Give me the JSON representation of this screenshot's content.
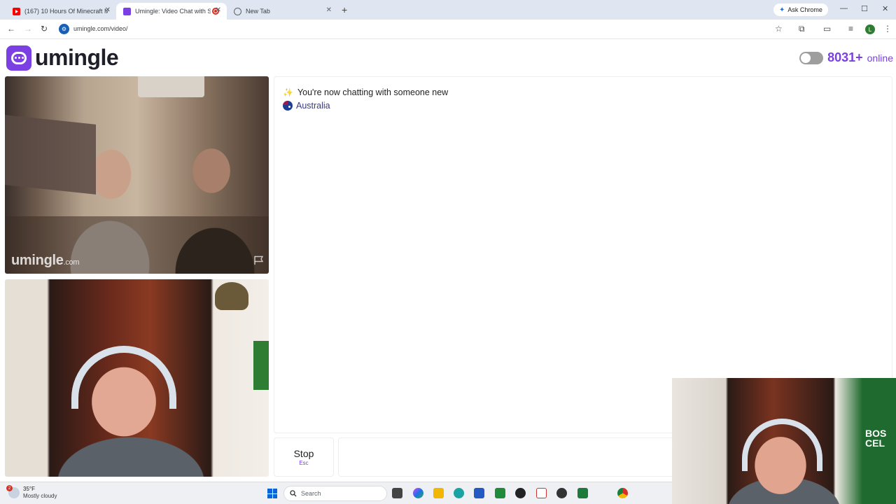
{
  "browser": {
    "tabs": [
      {
        "title": "(167) 10 Hours Of Minecraft M",
        "favicon": "youtube-icon",
        "color": "#ff0000"
      },
      {
        "title": "Umingle: Video Chat with S",
        "favicon": "umingle-icon",
        "color": "#7b3fe4"
      },
      {
        "title": "New Tab",
        "favicon": "chrome-icon",
        "color": "#5f6368"
      }
    ],
    "ask_chrome": "Ask Chrome",
    "url": "umingle.com/video/",
    "profile_initial": "L"
  },
  "page": {
    "logo_text": "umingle",
    "online_count": "8031+",
    "online_label": "online",
    "watermark": "umingle",
    "watermark_suffix": ".com",
    "chat_status": "You're now chatting with someone new",
    "country": "Australia",
    "stop_label": "Stop",
    "stop_shortcut": "Esc",
    "brand_color": "#7b3fe4"
  },
  "overlay": {
    "banner_text": "BOS\nCEL"
  },
  "taskbar": {
    "temperature": "35°F",
    "weather": "Mostly cloudy",
    "weather_badge": "2",
    "search_placeholder": "Search"
  }
}
